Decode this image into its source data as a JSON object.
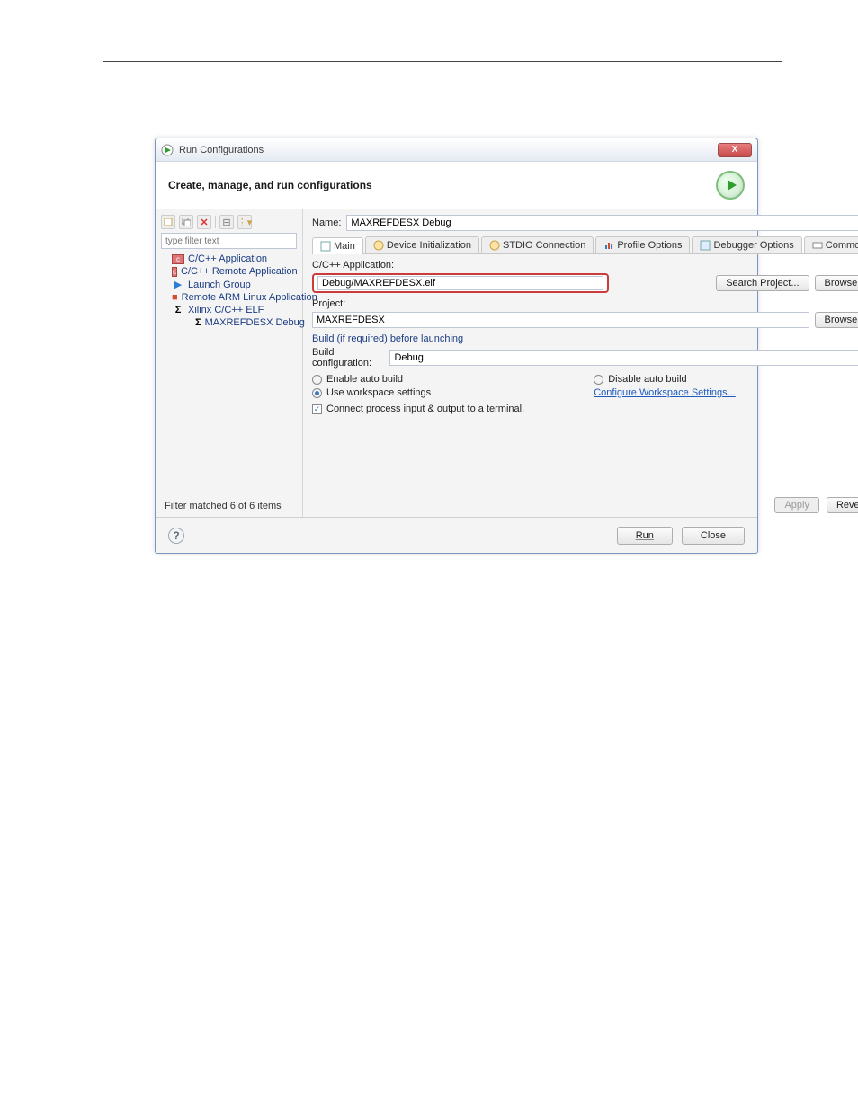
{
  "window": {
    "title": "Run Configurations",
    "header": "Create, manage, and run configurations"
  },
  "left": {
    "filter_placeholder": "type filter text",
    "tree": [
      {
        "icon": "c-app",
        "label": "C/C++ Application"
      },
      {
        "icon": "c-app",
        "label": "C/C++ Remote Application"
      },
      {
        "icon": "launch",
        "label": "Launch Group"
      },
      {
        "icon": "remote",
        "label": "Remote ARM Linux Application"
      },
      {
        "icon": "sigma",
        "label": "Xilinx C/C++ ELF"
      }
    ],
    "child": {
      "icon": "sigma",
      "label": "MAXREFDESX Debug"
    },
    "filter_matched": "Filter matched 6 of 6 items"
  },
  "form": {
    "name_label": "Name:",
    "name_value": "MAXREFDESX Debug",
    "tabs": [
      "Main",
      "Device Initialization",
      "STDIO Connection",
      "Profile Options",
      "Debugger Options",
      "Common"
    ],
    "app_label": "C/C++ Application:",
    "app_value": "Debug/MAXREFDESX.elf",
    "search_project": "Search Project...",
    "browse": "Browse...",
    "project_label": "Project:",
    "project_value": "MAXREFDESX",
    "build_section": "Build (if required) before launching",
    "build_config_label": "Build configuration:",
    "build_config_value": "Debug",
    "enable_auto": "Enable auto build",
    "disable_auto": "Disable auto build",
    "use_ws": "Use workspace settings",
    "conf_ws": "Configure Workspace Settings...",
    "connect_terminal": "Connect process input & output to a terminal.",
    "apply": "Apply",
    "revert": "Revert"
  },
  "footer": {
    "run": "Run",
    "close": "Close"
  }
}
